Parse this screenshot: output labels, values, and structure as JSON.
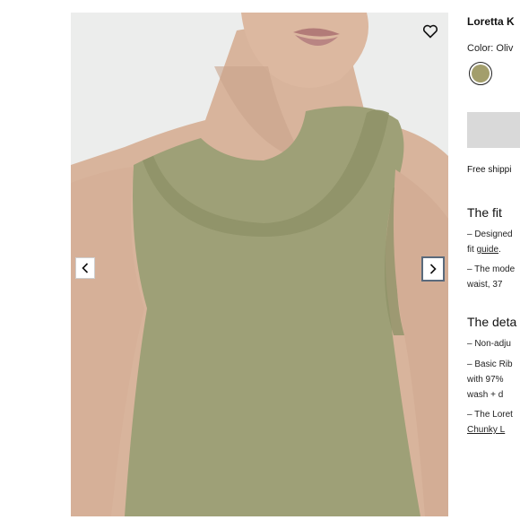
{
  "product": {
    "title": "Loretta K",
    "color_line": "Color: Oliv",
    "swatch_color": "#a39e6c",
    "shipping_text": "Free shippi"
  },
  "fit": {
    "heading": "The fit",
    "items": [
      {
        "line1": "– Designed",
        "line2_pre": "fit ",
        "line2_link": "guide",
        "line2_post": "."
      },
      {
        "line1": "– The mode",
        "line2": "waist, 37"
      }
    ]
  },
  "details": {
    "heading": "The deta",
    "items": [
      {
        "line1": "– Non-adju"
      },
      {
        "line1": "– Basic Rib",
        "line2": "with 97%",
        "line3": "wash + d"
      },
      {
        "line1": "– The Loret",
        "line2_link": "Chunky L"
      }
    ]
  },
  "gallery": {
    "icons": {
      "wishlist": "heart-icon",
      "prev": "chevron-left-icon",
      "next": "chevron-right-icon"
    },
    "colors": {
      "backdrop": "#ecedec",
      "top": "#9ea077",
      "skin": "#d8b49c"
    }
  }
}
